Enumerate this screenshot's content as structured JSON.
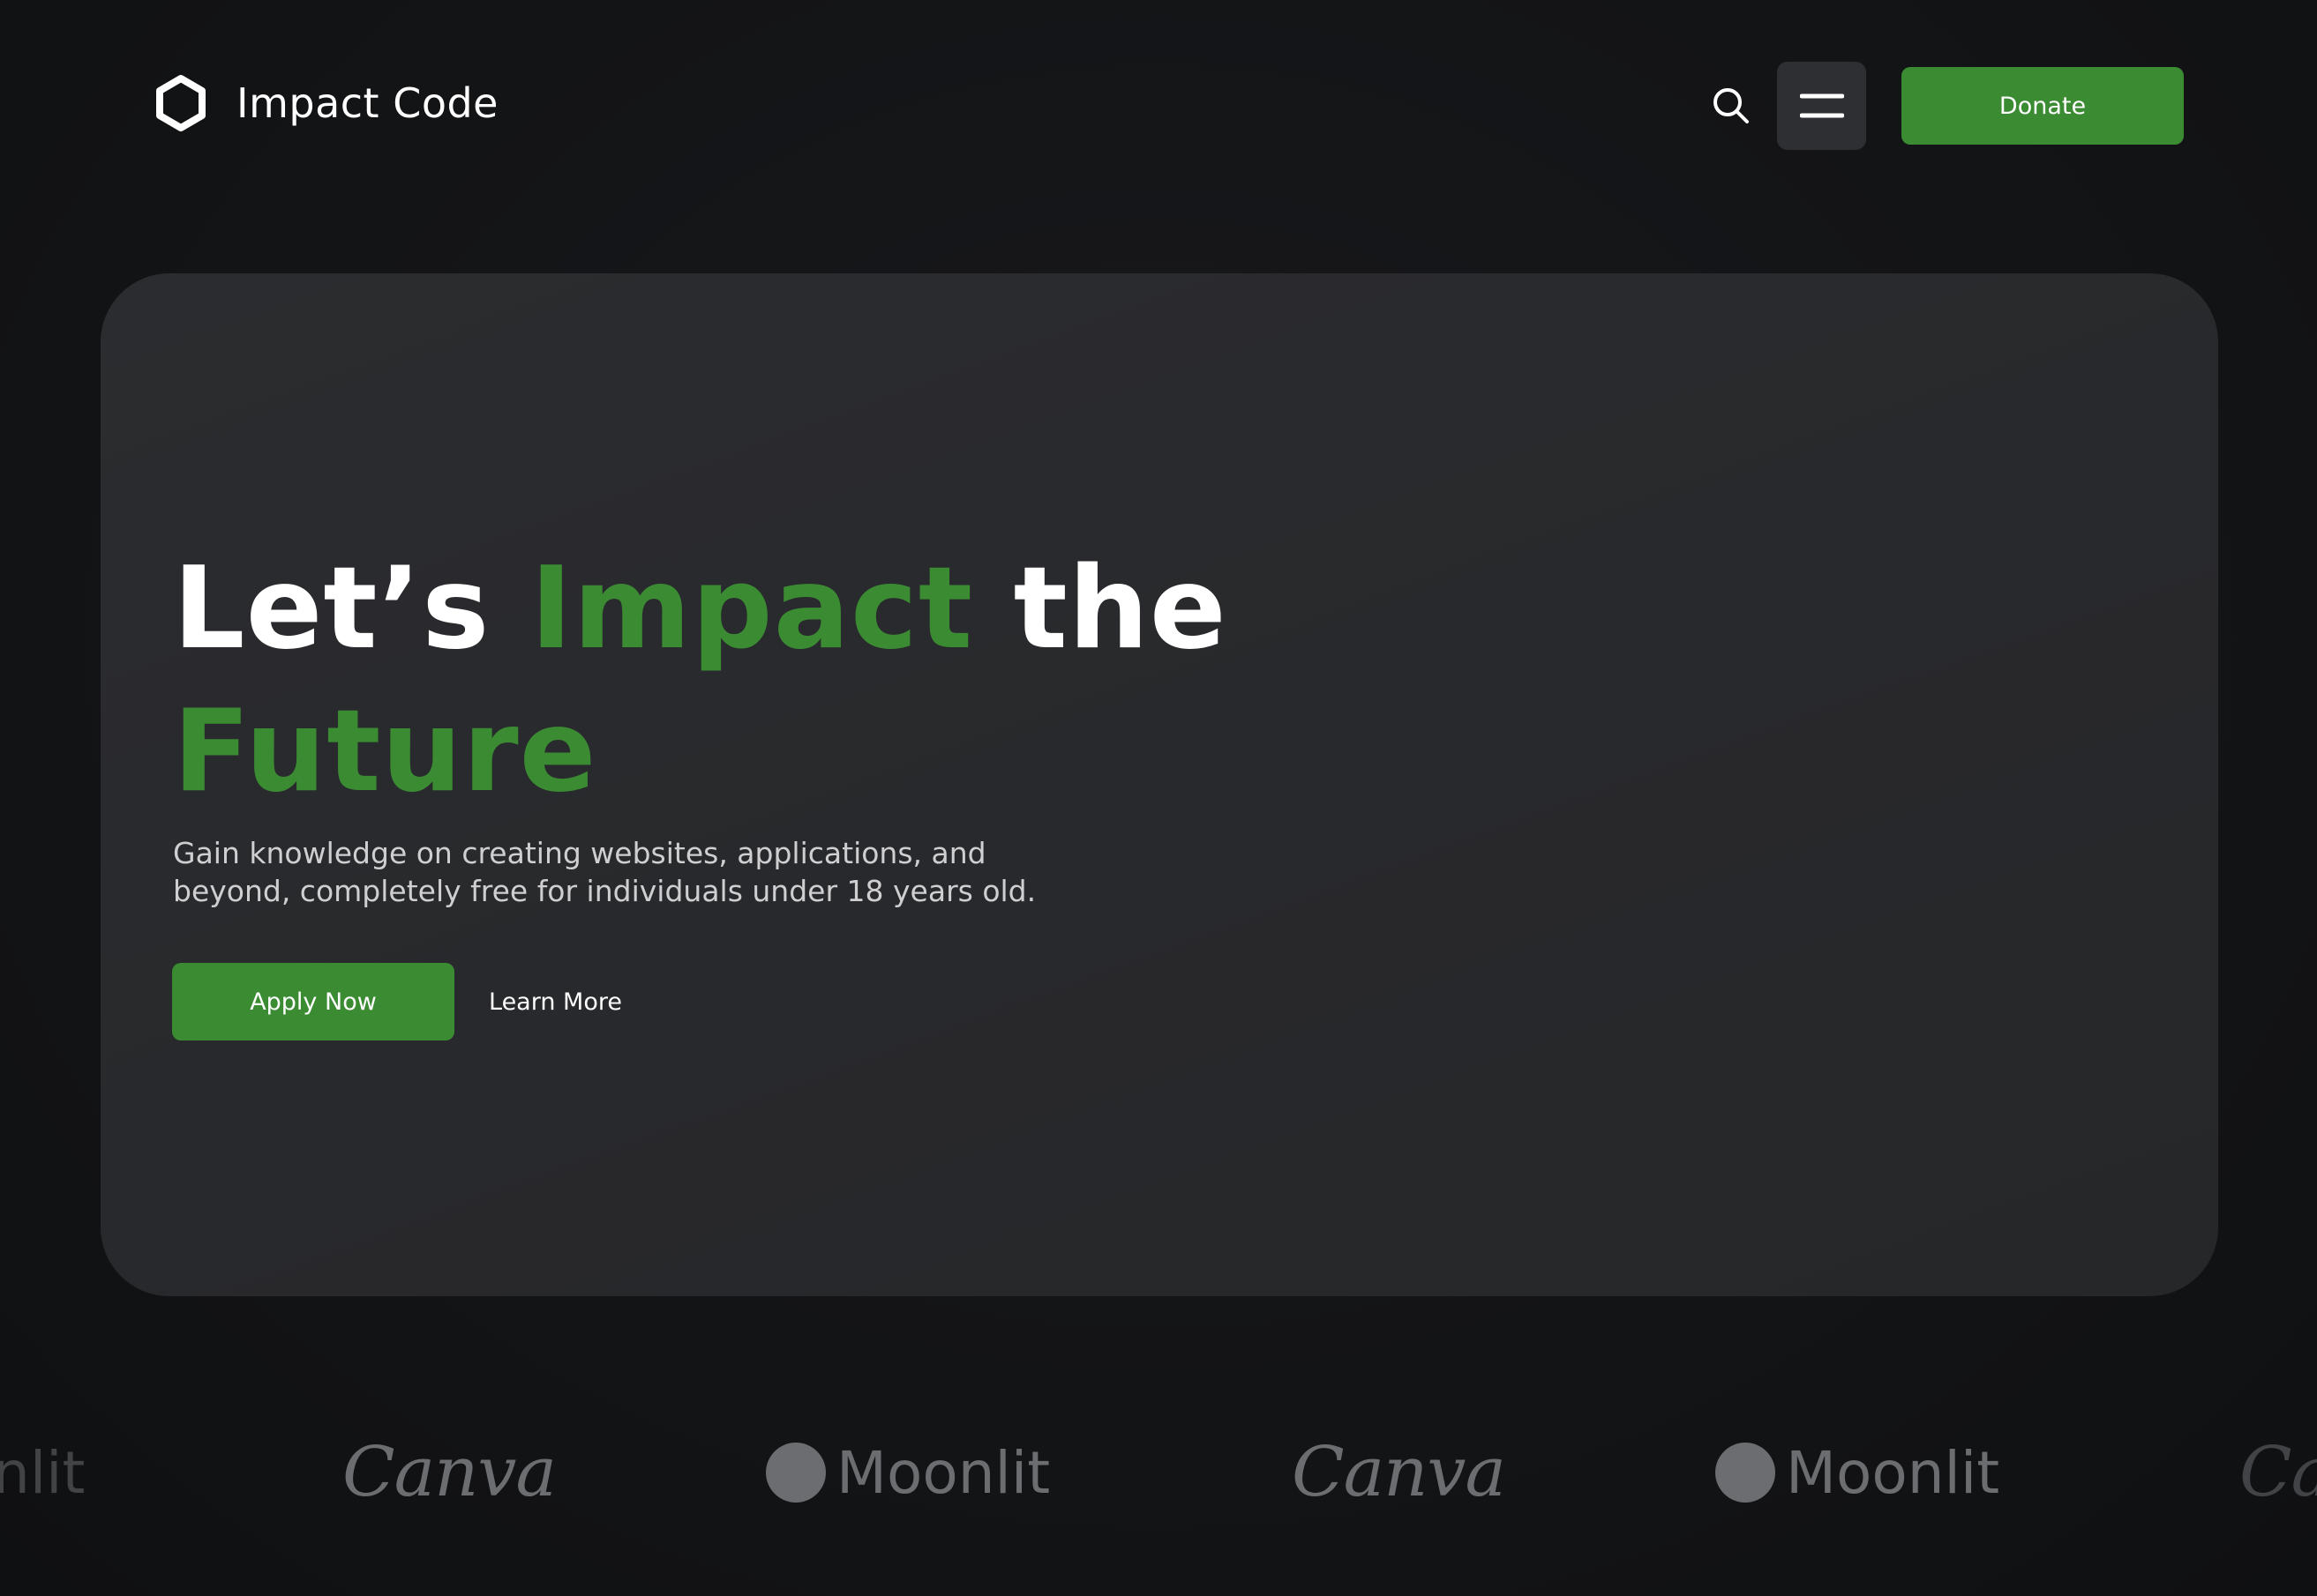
{
  "header": {
    "logo_text": "Impact Code",
    "donate_label": "Donate",
    "icons": {
      "logo": "hexagon-icon",
      "search": "search-icon",
      "menu": "menu-icon"
    }
  },
  "hero": {
    "title_part1": "Let’s ",
    "title_highlight1": "Impact",
    "title_part2": " the",
    "title_highlight2": "Future",
    "subtitle_line1": "Gain knowledge on creating websites, applications, and",
    "subtitle_line2": "beyond, completely free for individuals under 18 years old.",
    "apply_label": "Apply Now",
    "learn_label": "Learn More"
  },
  "logo_strip": {
    "items": [
      "nlit",
      "Canva",
      "Moonlit",
      "Canva",
      "Moonlit",
      "Ca"
    ]
  },
  "colors": {
    "background": "#141517",
    "card": "#2a2b2e",
    "accent": "#3b8b33",
    "text": "#ffffff",
    "muted_text": "#cfcfd2",
    "brand_logos": "#6c6d70"
  }
}
